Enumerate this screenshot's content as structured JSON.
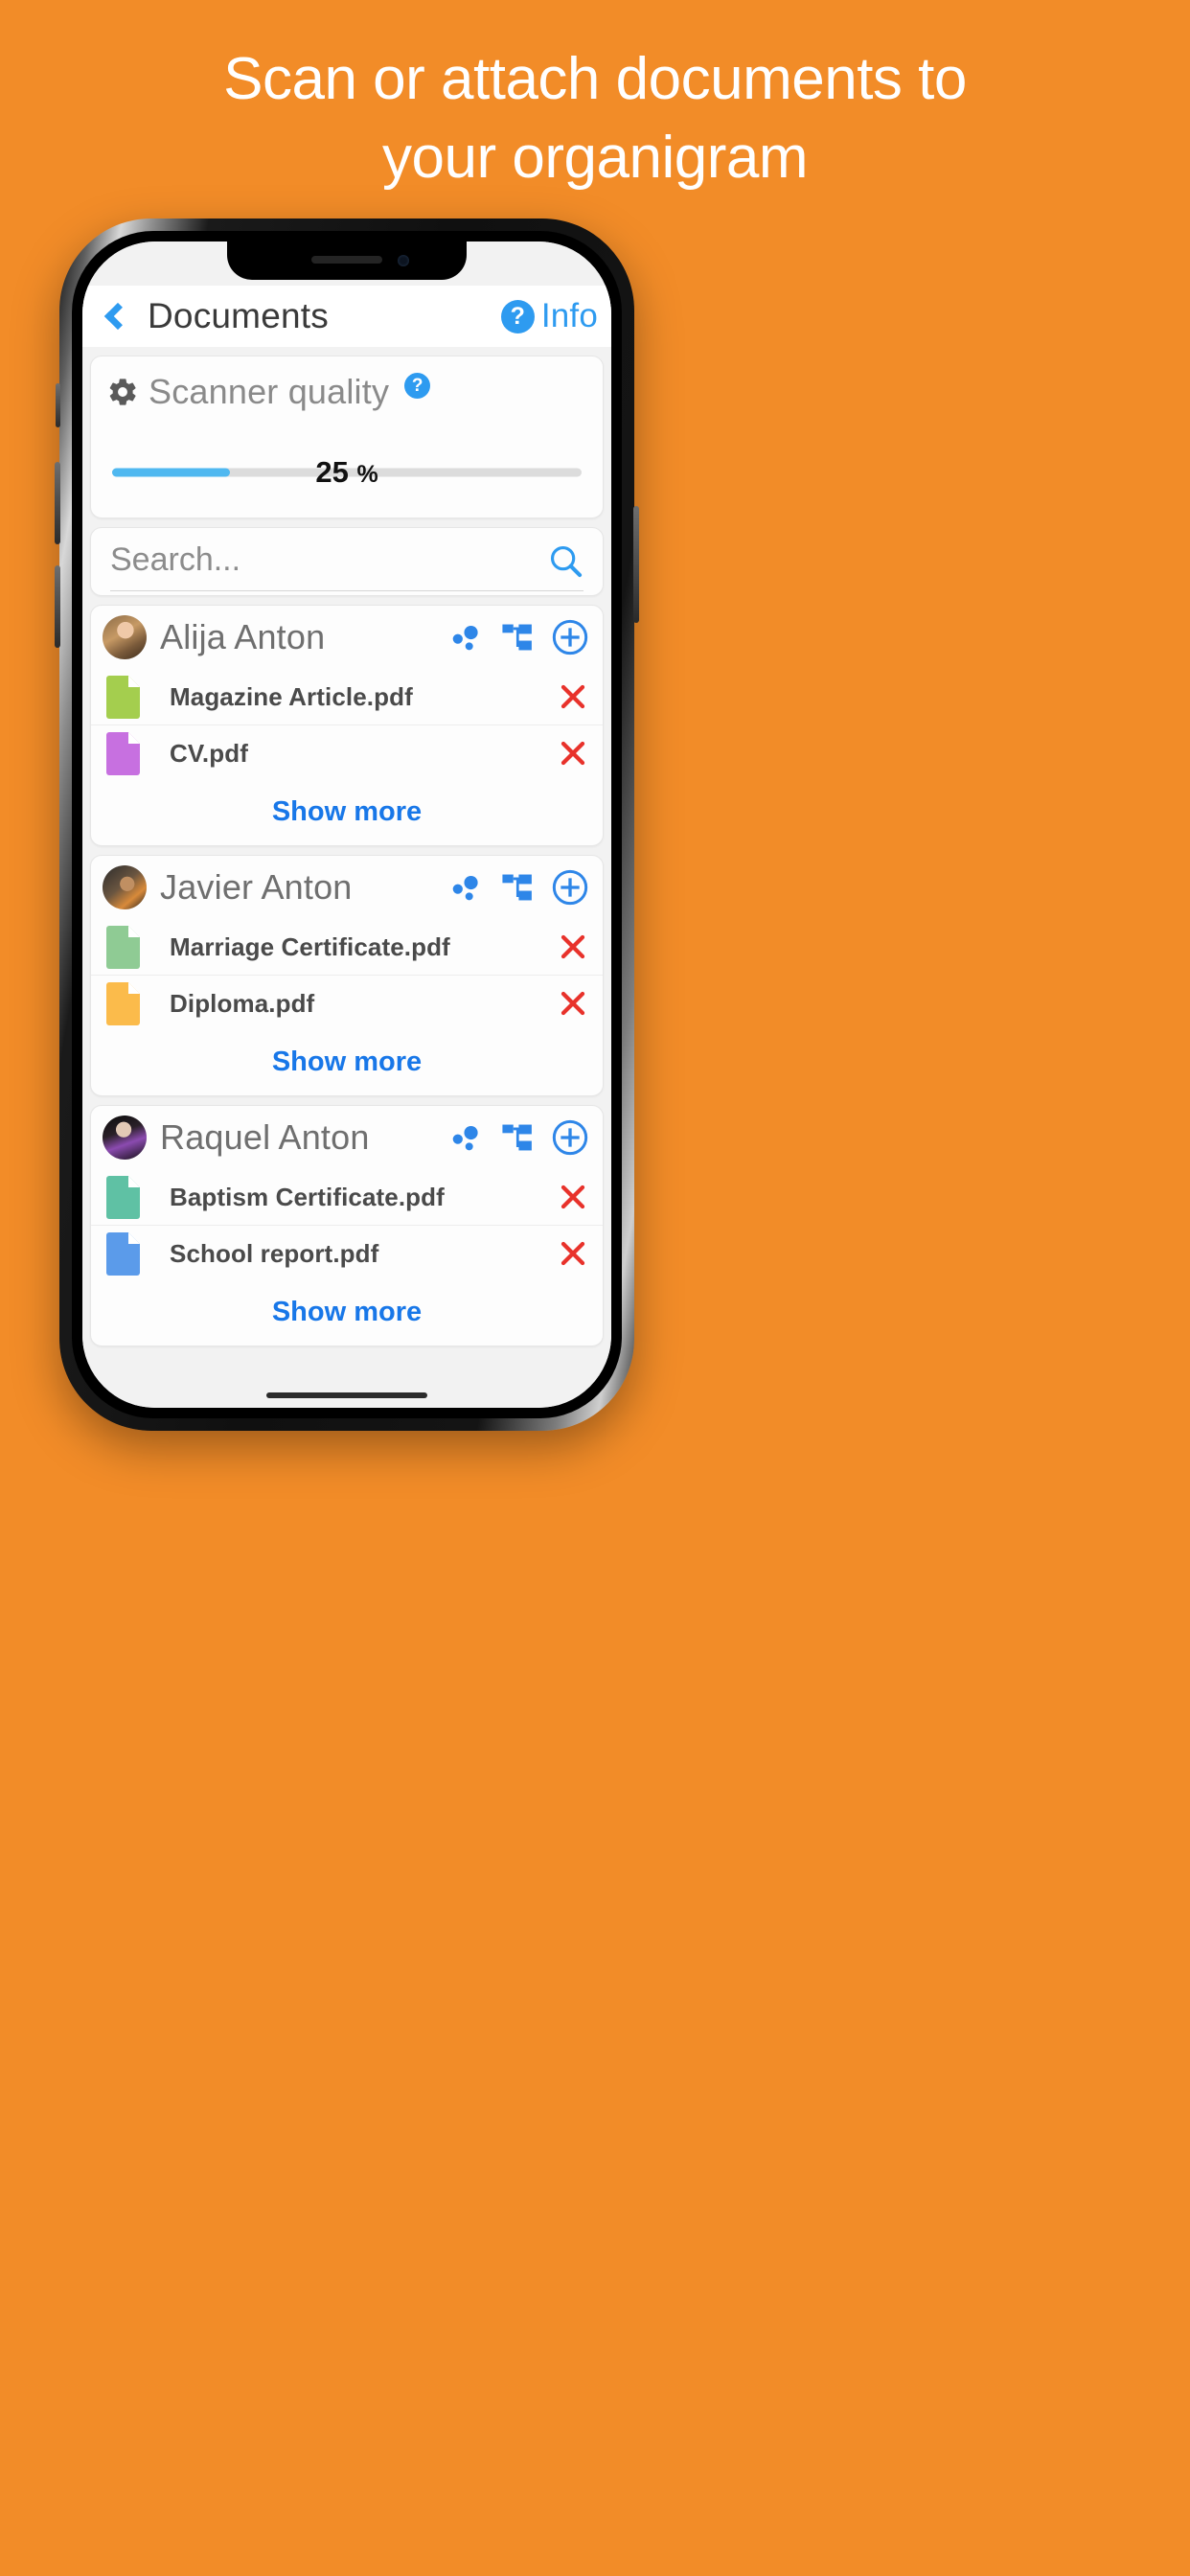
{
  "promo": {
    "line1": "Scan or attach documents to",
    "line2": "your organigram",
    "background_color": "#F28C28",
    "text_color": "#FFFFFF"
  },
  "navbar": {
    "back_icon": "chevron-left-icon",
    "title": "Documents",
    "info_badge": "?",
    "info_label": "Info",
    "accent_color": "#2E9BF0"
  },
  "scanner": {
    "gear_icon": "gear-icon",
    "title": "Scanner quality",
    "help_badge": "?",
    "value": 25,
    "value_text": "25",
    "unit": "%",
    "fill_color": "#4FB8F0",
    "track_color": "#DCDCDC"
  },
  "search": {
    "value": "",
    "placeholder": "Search...",
    "icon": "search-icon"
  },
  "people": [
    {
      "name": "Alija Anton",
      "avatar": "avatar-alija",
      "actions": [
        {
          "icon": "relations-bubbles-icon",
          "name": "relations-button"
        },
        {
          "icon": "organigram-icon",
          "name": "organigram-button"
        },
        {
          "icon": "plus-circle-icon",
          "name": "add-document-button"
        }
      ],
      "documents": [
        {
          "name": "Magazine Article.pdf",
          "color": "#A4CE4E",
          "delete_icon": "close-x-icon"
        },
        {
          "name": "CV.pdf",
          "color": "#C770E0",
          "delete_icon": "close-x-icon"
        }
      ],
      "show_more": "Show more"
    },
    {
      "name": "Javier Anton",
      "avatar": "avatar-javier",
      "actions": [
        {
          "icon": "relations-bubbles-icon",
          "name": "relations-button"
        },
        {
          "icon": "organigram-icon",
          "name": "organigram-button"
        },
        {
          "icon": "plus-circle-icon",
          "name": "add-document-button"
        }
      ],
      "documents": [
        {
          "name": "Marriage Certificate.pdf",
          "color": "#8FCB94",
          "delete_icon": "close-x-icon"
        },
        {
          "name": "Diploma.pdf",
          "color": "#FBBB4B",
          "delete_icon": "close-x-icon"
        }
      ],
      "show_more": "Show more"
    },
    {
      "name": "Raquel Anton",
      "avatar": "avatar-raquel",
      "actions": [
        {
          "icon": "relations-bubbles-icon",
          "name": "relations-button"
        },
        {
          "icon": "organigram-icon",
          "name": "organigram-button"
        },
        {
          "icon": "plus-circle-icon",
          "name": "add-document-button"
        }
      ],
      "documents": [
        {
          "name": "Baptism Certificate.pdf",
          "color": "#5FC1A4",
          "delete_icon": "close-x-icon"
        },
        {
          "name": "School report.pdf",
          "color": "#5B9BEA",
          "delete_icon": "close-x-icon"
        }
      ],
      "show_more": "Show more"
    }
  ],
  "colors": {
    "accent_blue": "#1877E8",
    "delete_red": "#E8322B",
    "orange_bg": "#F28C28"
  }
}
